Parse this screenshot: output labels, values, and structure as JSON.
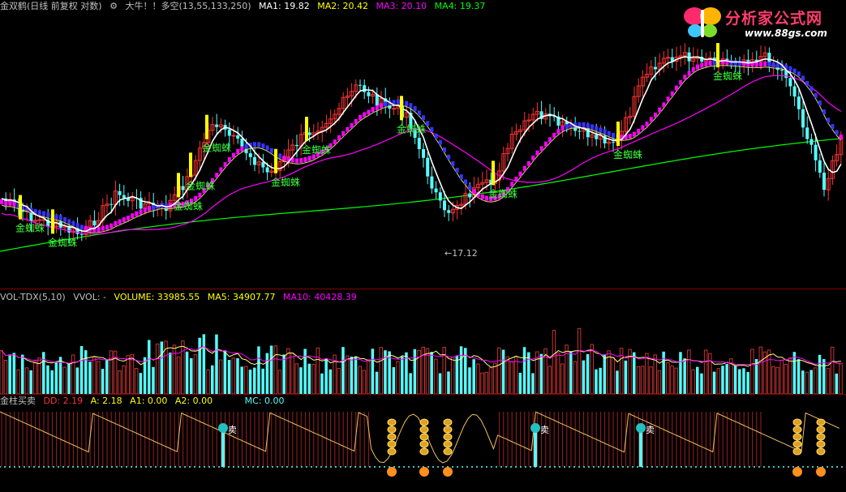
{
  "price_panel": {
    "title": "金双鹤(日线 前复权 对数)",
    "indicator_label": "大牛！！多空(13,55,133,250)",
    "ma1": "MA1: 19.82",
    "ma2": "MA2: 20.42",
    "ma3": "MA3: 20.10",
    "ma4": "MA4: 19.37",
    "signal_text": "金蜘蛛",
    "low_marker": "←17.12"
  },
  "volume_panel": {
    "title": "VOL-TDX(5,10)",
    "vvol": "VVOL: -",
    "volume": "VOLUME: 33985.55",
    "ma5": "MA5: 34907.77",
    "ma10": "MA10: 40428.39"
  },
  "indicator_panel": {
    "title": "金柱买卖",
    "dd": "DD: 2.19",
    "a": "A: 2.18",
    "a1": "A1: 0.00",
    "a2": "A2: 0.00",
    "mc": "MC: 0.00",
    "sell_label": "卖"
  },
  "logo": {
    "title": "分析家公式网",
    "url": "www.88gs.com"
  },
  "colors": {
    "up": "#ff3232",
    "down": "#54ffff",
    "ma1": "#ffffff",
    "ma2": "#ffff00",
    "ma3": "#ff00ff",
    "ma4": "#00ff00",
    "signal": "#3cff3c",
    "highlight": "#ffff00"
  },
  "chart_data": {
    "type": "candlestick",
    "low_price": 17.12,
    "signals_count": 12,
    "sell_signals_count": 3
  }
}
